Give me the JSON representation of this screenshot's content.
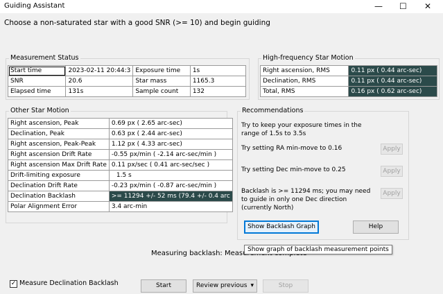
{
  "window": {
    "title": "Guiding Assistant",
    "minimize": "—",
    "maximize": "☐",
    "close": "✕"
  },
  "instruction": "Choose a non-saturated star with a good SNR (>= 10) and begin guiding",
  "measurement_status": {
    "title": "Measurement Status",
    "rows": [
      {
        "l1": "Start time",
        "v1": "2023-02-11 20:44:3",
        "l2": "Exposure time",
        "v2": "1s"
      },
      {
        "l1": "SNR",
        "v1": "20.6",
        "l2": "Star mass",
        "v2": "1165.3"
      },
      {
        "l1": "Elapsed time",
        "v1": "131s",
        "l2": "Sample count",
        "v2": "132"
      }
    ]
  },
  "high_frequency": {
    "title": "High-frequency Star Motion",
    "rows": [
      {
        "label": "Right ascension, RMS",
        "value": "0.11 px ( 0.44 arc-sec)"
      },
      {
        "label": "Declination, RMS",
        "value": "0.11 px ( 0.44 arc-sec)"
      },
      {
        "label": "Total, RMS",
        "value": "0.16 px ( 0.62 arc-sec)"
      }
    ]
  },
  "other_motion": {
    "title": "Other Star Motion",
    "rows": [
      {
        "label": "Right ascension, Peak",
        "value": "0.69 px ( 2.65 arc-sec)"
      },
      {
        "label": "Declination, Peak",
        "value": "0.63 px ( 2.44 arc-sec)"
      },
      {
        "label": "Right ascension, Peak-Peak",
        "value": "1.12 px ( 4.33 arc-sec)"
      },
      {
        "label": "Right ascension Drift Rate",
        "value": "-0.55 px/min ( -2.14 arc-sec/min )"
      },
      {
        "label": "Right ascension Max Drift Rate",
        "value": "0.11 px/sec ( 0.41 arc-sec/sec )"
      },
      {
        "label": "Drift-limiting exposure",
        "value": "1.5 s"
      },
      {
        "label": "Declination Drift Rate",
        "value": "-0.23 px/min ( -0.87 arc-sec/min )"
      },
      {
        "label": "Declination Backlash",
        "value": ">= 11294  +/-  52 ms (79.4  +/-  0.4 arc"
      },
      {
        "label": "Polar Alignment Error",
        "value": "3.4 arc-min"
      }
    ]
  },
  "recommendations": {
    "title": "Recommendations",
    "exposure_text": "Try to keep your exposure times in the range of 1.5s to 3.5s",
    "ra_text": "Try setting RA min-move to 0.16",
    "dec_text": "Try setting Dec min-move to 0.25",
    "backlash_text": "Backlash is >= 11294 ms; you may need to guide in only one Dec direction (currently North)",
    "apply_label": "Apply",
    "show_backlash_label": "Show Backlash Graph",
    "help_label": "Help"
  },
  "tooltip": "Show graph of backlash measurement points",
  "status_text": "Measuring backlash: Measurement complete",
  "checkbox": {
    "label": "Measure Declination Backlash",
    "checked": true,
    "mark": "✓"
  },
  "buttons": {
    "start": "Start",
    "review": "Review previous",
    "review_arrow": "▾",
    "stop": "Stop"
  }
}
